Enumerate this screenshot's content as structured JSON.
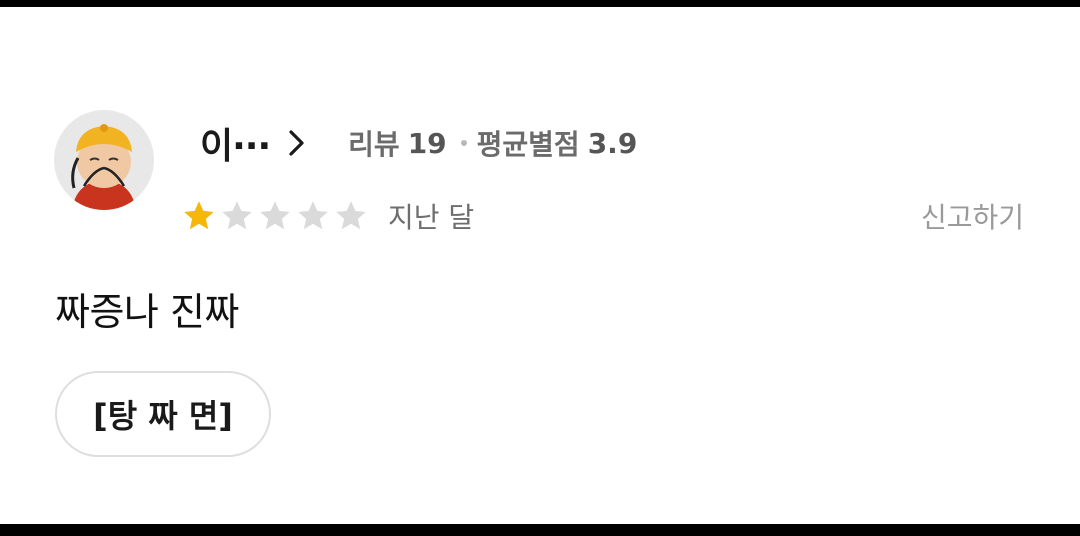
{
  "review": {
    "reviewer": {
      "nickname": "이···",
      "avatar_icon": "avatar-character-icon",
      "review_label": "리뷰",
      "review_count": "19",
      "avg_label": "평균별점",
      "avg_rating": "3.9"
    },
    "rating": {
      "value": 1,
      "max": 5,
      "filled_color": "#F5B70A",
      "empty_color": "#DADADA"
    },
    "date": "지난 달",
    "report_label": "신고하기",
    "text": "짜증나 진짜",
    "menu_items": [
      "[탕 짜 면]"
    ]
  }
}
